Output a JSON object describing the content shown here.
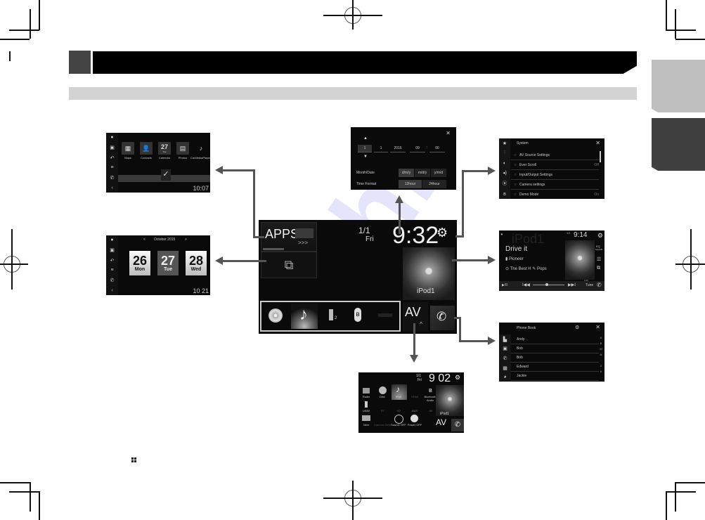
{
  "page": {
    "chapter_number": "",
    "chapter_title": "",
    "section_title": "",
    "footnote_icon": "grid-icon"
  },
  "apps_screen": {
    "apps": [
      {
        "label": "Maps",
        "icon": "map-icon"
      },
      {
        "label": "Contacts",
        "icon": "person-icon"
      },
      {
        "label": "Calendar",
        "icon": "calendar-icon",
        "day": "27",
        "weekday": "Tue"
      },
      {
        "label": "Photos",
        "icon": "photos-icon"
      },
      {
        "label": "CarMediaPlayer",
        "icon": "music-icon"
      }
    ],
    "clock": "10:07"
  },
  "calendar_screen": {
    "month": "October 2015",
    "prev": "<",
    "next": ">",
    "days": [
      {
        "num": "26",
        "day": "Mon",
        "selected": false
      },
      {
        "num": "27",
        "day": "Tue",
        "selected": true
      },
      {
        "num": "28",
        "day": "Wed",
        "selected": false
      }
    ],
    "clock": "10 21"
  },
  "time_settings_screen": {
    "fields": [
      "1",
      "1",
      "2016",
      "09",
      "00"
    ],
    "separator": ":",
    "month_date_label": "Month/Date",
    "month_date_options": [
      "d/m/y",
      "m/d/y",
      "y/m/d"
    ],
    "time_format_label": "Time Format",
    "time_format_options": [
      "12hour",
      "24hour"
    ],
    "close": "✕"
  },
  "system_screen": {
    "title": "System",
    "close": "✕",
    "items": [
      {
        "label": "AV Source Settings",
        "value": ""
      },
      {
        "label": "Ever Scroll",
        "value": "Off"
      },
      {
        "label": "Input/Output Settings",
        "value": ""
      },
      {
        "label": "Camera settings",
        "value": ""
      },
      {
        "label": "Demo Mode",
        "value": "On"
      }
    ]
  },
  "av_screen": {
    "source_bg": "iPod1",
    "track": "Drive it",
    "artist": "Pioneer",
    "album": "The Best H",
    "genre": "Pops",
    "date": "1/1",
    "time": "9:14",
    "eq_label": "EQ",
    "eq_value": "SuperB",
    "track_count": "1/20",
    "tune": "Tune"
  },
  "phone_screen": {
    "title": "Phone Book",
    "close": "✕",
    "contacts": [
      "Andy",
      "Bob",
      "Bob",
      "Edward",
      "Jackie"
    ],
    "index": [
      "A",
      "B",
      "",
      "M",
      "N",
      ":",
      "Z",
      "#"
    ]
  },
  "top_menu": {
    "apps_label": "APPS",
    "apps_more": ">>>",
    "date": "1/1",
    "weekday": "Fri",
    "time": "9:32",
    "source_name": "iPod1",
    "av_label": "AV",
    "av_caret": "^",
    "usb_sub": "2",
    "sources": [
      {
        "name": "disc",
        "icon": "disc-icon"
      },
      {
        "name": "ipod",
        "icon": "music-note-icon"
      },
      {
        "name": "usb",
        "icon": "usb-icon"
      },
      {
        "name": "bluetooth",
        "icon": "bluetooth-icon"
      },
      {
        "name": "aux",
        "icon": "aux-icon"
      }
    ]
  },
  "source_menu_screen": {
    "date": "1/1",
    "weekday": "Fri",
    "time": "9 02",
    "sources": [
      [
        "Radio",
        "Disc",
        "iPod",
        "HDMI",
        "Bluetooth Audio"
      ],
      [
        "USB2",
        "TV",
        "SD",
        "AUX",
        "AV"
      ],
      [
        "New",
        "Camera View",
        "Source OFF",
        "Power OFF",
        ""
      ]
    ],
    "source_name": "iPod1",
    "av_label": "AV"
  }
}
